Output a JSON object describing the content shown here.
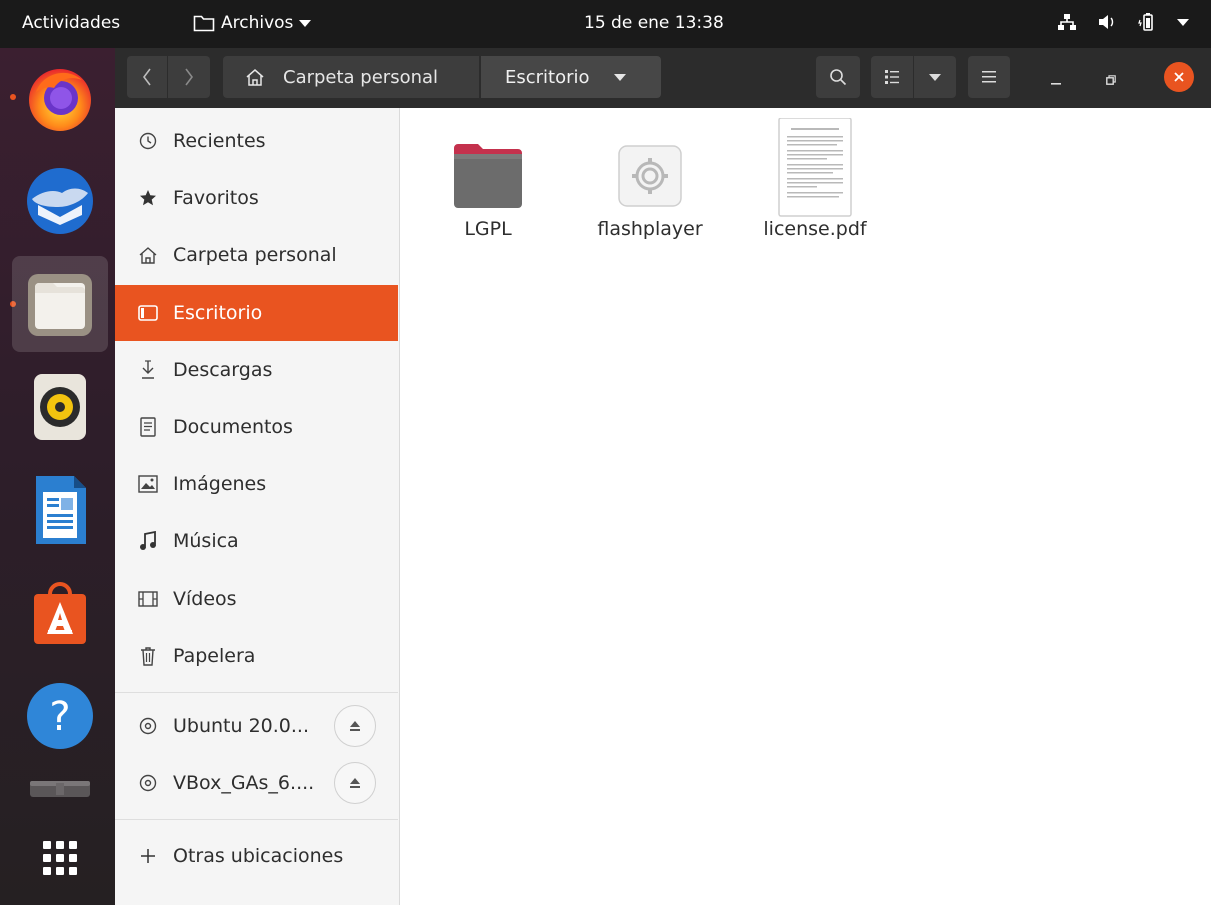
{
  "topbar": {
    "activities": "Actividades",
    "app_name": "Archivos",
    "clock": "15 de ene 13:38",
    "icons": [
      "network-icon",
      "volume-icon",
      "battery-icon",
      "system-menu-icon"
    ]
  },
  "dock": {
    "apps": [
      "firefox-icon",
      "thunderbird-icon",
      "files-icon",
      "rhythmbox-icon",
      "libreoffice-writer-icon",
      "ubuntu-software-icon",
      "help-icon",
      "removable-drive-icon",
      "show-apps-icon"
    ]
  },
  "header": {
    "path_home": "Carpeta personal",
    "path_current": "Escritorio"
  },
  "sidebar": {
    "places": [
      {
        "label": "Recientes",
        "icon": "clock-icon"
      },
      {
        "label": "Favoritos",
        "icon": "star-icon"
      },
      {
        "label": "Carpeta personal",
        "icon": "home-icon"
      },
      {
        "label": "Escritorio",
        "icon": "desktop-icon",
        "active": true
      },
      {
        "label": "Descargas",
        "icon": "download-icon"
      },
      {
        "label": "Documentos",
        "icon": "document-icon"
      },
      {
        "label": "Imágenes",
        "icon": "image-icon"
      },
      {
        "label": "Música",
        "icon": "music-icon"
      },
      {
        "label": "Vídeos",
        "icon": "video-icon"
      },
      {
        "label": "Papelera",
        "icon": "trash-icon"
      }
    ],
    "devices": [
      {
        "label": "Ubuntu 20.0...",
        "icon": "disc-icon"
      },
      {
        "label": "VBox_GAs_6....",
        "icon": "disc-icon"
      }
    ],
    "other": "Otras ubicaciones"
  },
  "files": [
    {
      "name": "LGPL",
      "type": "folder"
    },
    {
      "name": "flashplayer",
      "type": "executable"
    },
    {
      "name": "license.pdf",
      "type": "pdf"
    }
  ],
  "colors": {
    "accent": "#e95420",
    "topbar": "#1a1a1a",
    "headerbar": "#2c2c2c"
  }
}
